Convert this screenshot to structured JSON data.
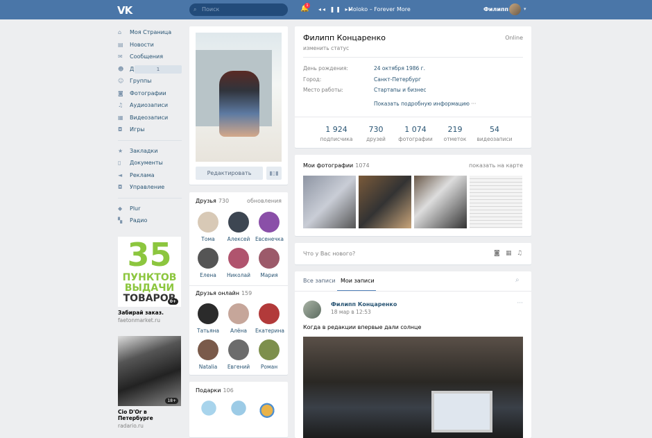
{
  "header": {
    "search_placeholder": "Поиск",
    "notifications_count": "1",
    "player_track": "Moloko – Forever More",
    "user_name": "Филипп"
  },
  "menu": [
    {
      "label": "Моя Страница",
      "icon": "home-icon"
    },
    {
      "label": "Новости",
      "icon": "news-icon"
    },
    {
      "label": "Сообщения",
      "icon": "messages-icon"
    },
    {
      "label": "Друзья",
      "icon": "friends-icon",
      "count": "1"
    },
    {
      "label": "Группы",
      "icon": "groups-icon"
    },
    {
      "label": "Фотографии",
      "icon": "camera-icon"
    },
    {
      "label": "Аудиозаписи",
      "icon": "music-icon"
    },
    {
      "label": "Видеозаписи",
      "icon": "video-icon"
    },
    {
      "label": "Игры",
      "icon": "gamepad-icon"
    },
    {
      "label": "Закладки",
      "icon": "star-icon"
    },
    {
      "label": "Документы",
      "icon": "document-icon"
    },
    {
      "label": "Реклама",
      "icon": "megaphone-icon"
    },
    {
      "label": "Управление",
      "icon": "gamepad-icon"
    },
    {
      "label": "Plur",
      "icon": "app-icon"
    },
    {
      "label": "Радио",
      "icon": "apps-icon"
    }
  ],
  "ads": [
    {
      "number": "35",
      "line1": "ПУНКТОВ",
      "line2": "ВЫДАЧИ",
      "line3": "ТОВАРОВ",
      "tag": "0+",
      "title": "Забирай заказ.",
      "site": "faetonmarket.ru"
    },
    {
      "tag": "18+",
      "title": "Cio D'Or в Петербурге",
      "site": "radario.ru"
    }
  ],
  "profile": {
    "edit_label": "Редактировать",
    "name": "Филипп Концаренко",
    "online": "Online",
    "status": "изменить статус",
    "birthday_label": "День рождения:",
    "birthday": "24 октября 1986 г.",
    "city_label": "Город:",
    "city": "Санкт-Петербург",
    "work_label": "Место работы:",
    "work": "Стартапы и бизнес",
    "more": "Показать подробную информацию",
    "counters": [
      {
        "value": "1 924",
        "label": "подписчика"
      },
      {
        "value": "730",
        "label": "друзей"
      },
      {
        "value": "1 074",
        "label": "фотографии"
      },
      {
        "value": "219",
        "label": "отметок"
      },
      {
        "value": "54",
        "label": "видеозаписи"
      }
    ]
  },
  "friends": {
    "title": "Друзья",
    "count": "730",
    "updates": "обновления",
    "list": [
      {
        "name": "Тома",
        "color": "#d8c9b6"
      },
      {
        "name": "Алексей",
        "color": "#3d4652"
      },
      {
        "name": "Евсенечка",
        "color": "#8a4fa8"
      },
      {
        "name": "Елена",
        "color": "#555555"
      },
      {
        "name": "Николай",
        "color": "#b0546e"
      },
      {
        "name": "Мария",
        "color": "#9c5a6a"
      }
    ],
    "online_title": "Друзья онлайн",
    "online_count": "159",
    "online_list": [
      {
        "name": "Татьяна",
        "color": "#2b2b2b"
      },
      {
        "name": "Алёна",
        "color": "#c6a69a"
      },
      {
        "name": "Екатерина",
        "color": "#b23a3a"
      },
      {
        "name": "Natalia",
        "color": "#7a5a4a"
      },
      {
        "name": "Евгений",
        "color": "#6c6c6c"
      },
      {
        "name": "Роман",
        "color": "#7d8f4c"
      }
    ]
  },
  "gifts": {
    "title": "Подарки",
    "count": "106"
  },
  "photos": {
    "title": "Мои фотографии",
    "count": "1074",
    "map_link": "показать на карте"
  },
  "newpost": {
    "placeholder": "Что у Вас нового?"
  },
  "wall": {
    "tab_all": "Все записи",
    "tab_mine": "Мои записи",
    "post": {
      "author": "Филипп Концаренко",
      "date": "18 мар в 12:53",
      "text": "Когда в редакции впервые дали солнце"
    }
  }
}
